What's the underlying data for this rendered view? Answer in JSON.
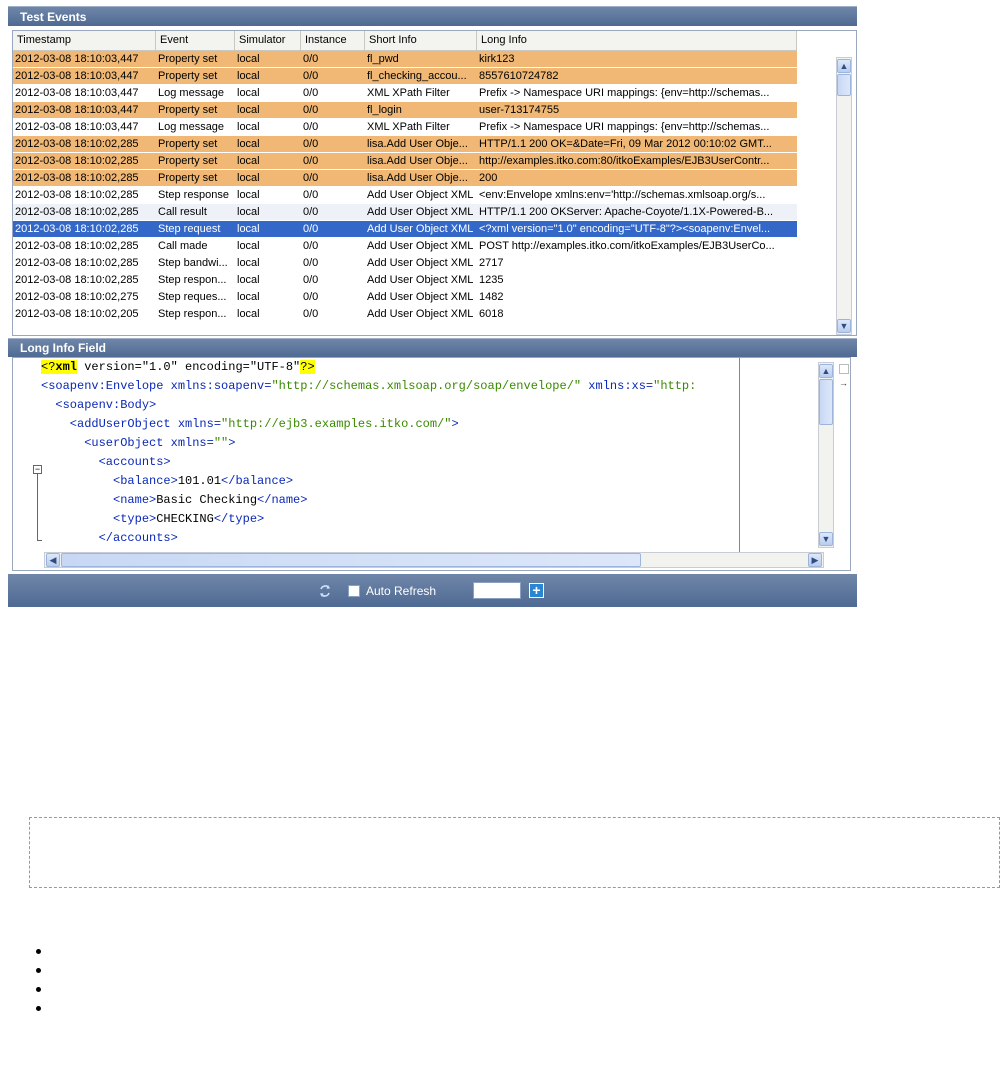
{
  "events_panel": {
    "title": "Test Events",
    "columns": [
      "Timestamp",
      "Event",
      "Simulator",
      "Instance",
      "Short Info",
      "Long Info"
    ],
    "rows": [
      {
        "ts": "2012-03-08 18:10:03,447",
        "event": "Property set",
        "sim": "local",
        "inst": "0/0",
        "short": "fl_pwd",
        "long": "kirk123",
        "style": "orange"
      },
      {
        "ts": "2012-03-08 18:10:03,447",
        "event": "Property set",
        "sim": "local",
        "inst": "0/0",
        "short": "fl_checking_accou...",
        "long": "8557610724782",
        "style": "orange"
      },
      {
        "ts": "2012-03-08 18:10:03,447",
        "event": "Log message",
        "sim": "local",
        "inst": "0/0",
        "short": "XML XPath Filter",
        "long": "Prefix -> Namespace URI mappings: {env=http://schemas...",
        "style": "white"
      },
      {
        "ts": "2012-03-08 18:10:03,447",
        "event": "Property set",
        "sim": "local",
        "inst": "0/0",
        "short": "fl_login",
        "long": "user-713174755",
        "style": "orange"
      },
      {
        "ts": "2012-03-08 18:10:03,447",
        "event": "Log message",
        "sim": "local",
        "inst": "0/0",
        "short": "XML XPath Filter",
        "long": "Prefix -> Namespace URI mappings: {env=http://schemas...",
        "style": "white"
      },
      {
        "ts": "2012-03-08 18:10:02,285",
        "event": "Property set",
        "sim": "local",
        "inst": "0/0",
        "short": "lisa.Add User Obje...",
        "long": "HTTP/1.1 200 OK=&Date=Fri, 09 Mar 2012 00:10:02 GMT...",
        "style": "orange"
      },
      {
        "ts": "2012-03-08 18:10:02,285",
        "event": "Property set",
        "sim": "local",
        "inst": "0/0",
        "short": "lisa.Add User Obje...",
        "long": "http://examples.itko.com:80/itkoExamples/EJB3UserContr...",
        "style": "orange"
      },
      {
        "ts": "2012-03-08 18:10:02,285",
        "event": "Property set",
        "sim": "local",
        "inst": "0/0",
        "short": "lisa.Add User Obje...",
        "long": "200",
        "style": "orange"
      },
      {
        "ts": "2012-03-08 18:10:02,285",
        "event": "Step response",
        "sim": "local",
        "inst": "0/0",
        "short": "Add User Object XML",
        "long": "<env:Envelope xmlns:env='http://schemas.xmlsoap.org/s...",
        "style": "white"
      },
      {
        "ts": "2012-03-08 18:10:02,285",
        "event": "Call result",
        "sim": "local",
        "inst": "0/0",
        "short": "Add User Object XML",
        "long": "HTTP/1.1 200 OKServer: Apache-Coyote/1.1X-Powered-B...",
        "style": "alt"
      },
      {
        "ts": "2012-03-08 18:10:02,285",
        "event": "Step request",
        "sim": "local",
        "inst": "0/0",
        "short": "Add User Object XML",
        "long": "<?xml version=\"1.0\" encoding=\"UTF-8\"?><soapenv:Envel...",
        "style": "sel"
      },
      {
        "ts": "2012-03-08 18:10:02,285",
        "event": "Call made",
        "sim": "local",
        "inst": "0/0",
        "short": "Add User Object XML",
        "long": "POST http://examples.itko.com/itkoExamples/EJB3UserCo...",
        "style": "white"
      },
      {
        "ts": "2012-03-08 18:10:02,285",
        "event": "Step bandwi...",
        "sim": "local",
        "inst": "0/0",
        "short": "Add User Object XML",
        "long": "2717",
        "style": "white"
      },
      {
        "ts": "2012-03-08 18:10:02,285",
        "event": "Step respon...",
        "sim": "local",
        "inst": "0/0",
        "short": "Add User Object XML",
        "long": "1235",
        "style": "white"
      },
      {
        "ts": "2012-03-08 18:10:02,275",
        "event": "Step reques...",
        "sim": "local",
        "inst": "0/0",
        "short": "Add User Object XML",
        "long": "1482",
        "style": "white"
      },
      {
        "ts": "2012-03-08 18:10:02,205",
        "event": "Step respon...",
        "sim": "local",
        "inst": "0/0",
        "short": "Add User Object XML",
        "long": "6018",
        "style": "white"
      }
    ]
  },
  "long_info_panel": {
    "title": "Long Info Field",
    "lines": [
      [
        {
          "t": "<?",
          "c": "pi"
        },
        {
          "t": "xml",
          "c": "pik"
        },
        {
          "t": " version=\"1.0\" encoding=\"UTF-8\"",
          "c": "txt"
        },
        {
          "t": "?>",
          "c": "pi"
        }
      ],
      [
        {
          "t": "<soapenv:Envelope ",
          "c": "tag"
        },
        {
          "t": "xmlns:soapenv=",
          "c": "tag"
        },
        {
          "t": "\"http://schemas.xmlsoap.org/soap/envelope/\"",
          "c": "val"
        },
        {
          "t": " xmlns:xs=",
          "c": "tag"
        },
        {
          "t": "\"http:",
          "c": "val"
        }
      ],
      [
        {
          "t": "  <soapenv:Body>",
          "c": "tag"
        }
      ],
      [
        {
          "t": "    <addUserObject ",
          "c": "tag"
        },
        {
          "t": "xmlns=",
          "c": "tag"
        },
        {
          "t": "\"http://ejb3.examples.itko.com/\"",
          "c": "val"
        },
        {
          "t": ">",
          "c": "tag"
        }
      ],
      [
        {
          "t": "      <userObject ",
          "c": "tag"
        },
        {
          "t": "xmlns=",
          "c": "tag"
        },
        {
          "t": "\"\"",
          "c": "val"
        },
        {
          "t": ">",
          "c": "tag"
        }
      ],
      [
        {
          "t": "        <accounts>",
          "c": "tag"
        }
      ],
      [
        {
          "t": "          <balance>",
          "c": "tag"
        },
        {
          "t": "101.01",
          "c": "txt"
        },
        {
          "t": "</balance>",
          "c": "tag"
        }
      ],
      [
        {
          "t": "          <name>",
          "c": "tag"
        },
        {
          "t": "Basic Checking",
          "c": "txt"
        },
        {
          "t": "</name>",
          "c": "tag"
        }
      ],
      [
        {
          "t": "          <type>",
          "c": "tag"
        },
        {
          "t": "CHECKING",
          "c": "txt"
        },
        {
          "t": "</type>",
          "c": "tag"
        }
      ],
      [
        {
          "t": "        </accounts>",
          "c": "tag"
        }
      ]
    ]
  },
  "toolbar": {
    "auto_refresh_label": "Auto Refresh",
    "refresh_icon": "refresh-icon",
    "add_icon": "plus-icon"
  },
  "colors": {
    "header_bar": "#5b7399",
    "property_set_row": "#f0b874",
    "selected_row": "#3468c8"
  }
}
